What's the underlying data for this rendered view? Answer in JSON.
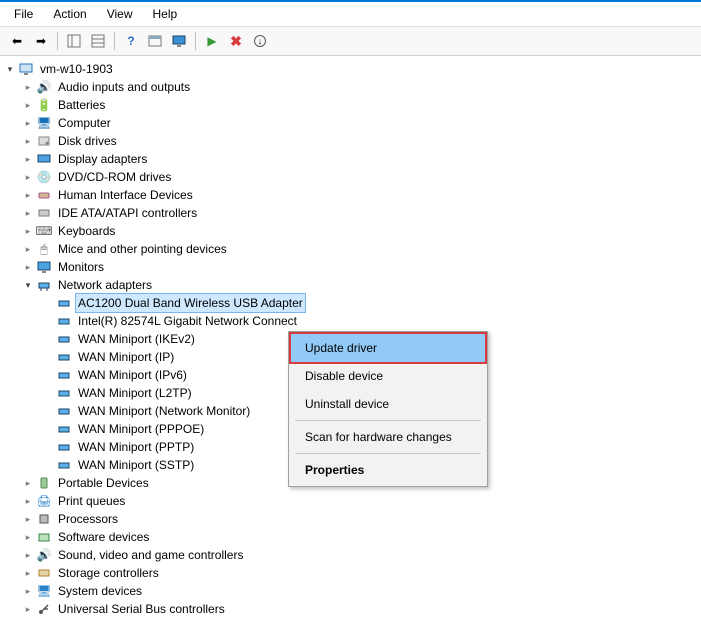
{
  "menu": {
    "file": "File",
    "action": "Action",
    "view": "View",
    "help": "Help"
  },
  "root": {
    "label": "vm-w10-1903"
  },
  "categories": {
    "audio": "Audio inputs and outputs",
    "batteries": "Batteries",
    "computer": "Computer",
    "disk": "Disk drives",
    "display": "Display adapters",
    "dvd": "DVD/CD-ROM drives",
    "hid": "Human Interface Devices",
    "ide": "IDE ATA/ATAPI controllers",
    "keyboards": "Keyboards",
    "mice": "Mice and other pointing devices",
    "monitors": "Monitors",
    "network": "Network adapters",
    "portable": "Portable Devices",
    "print": "Print queues",
    "processors": "Processors",
    "software": "Software devices",
    "sound": "Sound, video and game controllers",
    "storage": "Storage controllers",
    "system": "System devices",
    "usb": "Universal Serial Bus controllers"
  },
  "network_children": {
    "ac1200": "AC1200  Dual Band Wireless USB Adapter",
    "intel": "Intel(R) 82574L Gigabit Network Connect",
    "ikev2": "WAN Miniport (IKEv2)",
    "ip": "WAN Miniport (IP)",
    "ipv6": "WAN Miniport (IPv6)",
    "l2tp": "WAN Miniport (L2TP)",
    "netmon": "WAN Miniport (Network Monitor)",
    "pppoe": "WAN Miniport (PPPOE)",
    "pptp": "WAN Miniport (PPTP)",
    "sstp": "WAN Miniport (SSTP)"
  },
  "context_menu": {
    "update": "Update driver",
    "disable": "Disable device",
    "uninstall": "Uninstall device",
    "scan": "Scan for hardware changes",
    "properties": "Properties"
  }
}
